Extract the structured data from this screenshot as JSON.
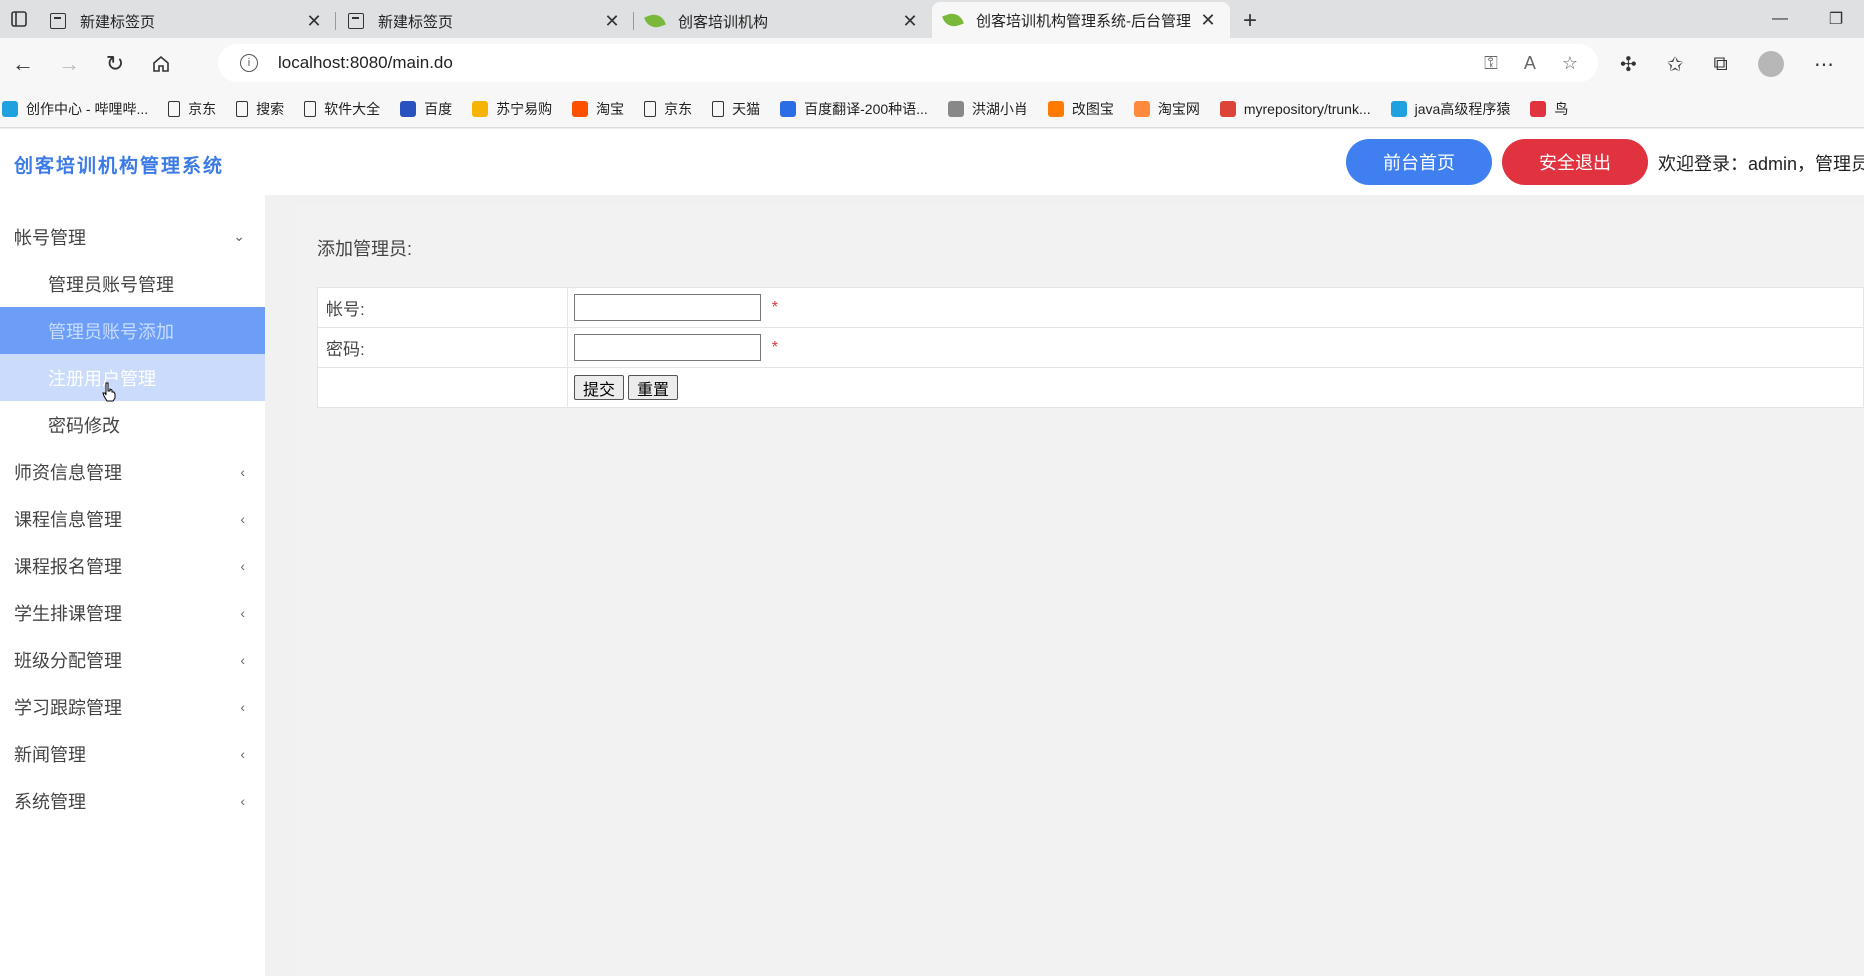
{
  "browser": {
    "tabs": [
      {
        "title": "新建标签页",
        "icon": "page-icon",
        "active": false
      },
      {
        "title": "新建标签页",
        "icon": "page-icon",
        "active": false
      },
      {
        "title": "创客培训机构",
        "icon": "leaf-icon",
        "active": false
      },
      {
        "title": "创客培训机构管理系统-后台管理",
        "icon": "leaf-icon",
        "active": true
      }
    ],
    "url": "localhost:8080/main.do",
    "bookmarks": [
      {
        "label": "创作中心 - 哔哩哔...",
        "icon": "bilibili-icon",
        "color": "#1fa1e0"
      },
      {
        "label": "京东",
        "icon": "page-icon"
      },
      {
        "label": "搜索",
        "icon": "page-icon"
      },
      {
        "label": "软件大全",
        "icon": "page-icon"
      },
      {
        "label": "百度",
        "icon": "baidu-paw-icon",
        "color": "#2a52be"
      },
      {
        "label": "苏宁易购",
        "icon": "suning-icon",
        "color": "#f5b400"
      },
      {
        "label": "淘宝",
        "icon": "taobao-icon",
        "color": "#ff5000"
      },
      {
        "label": "京东",
        "icon": "page-icon"
      },
      {
        "label": "天猫",
        "icon": "page-icon"
      },
      {
        "label": "百度翻译-200种语...",
        "icon": "translate-icon",
        "color": "#2b6de5"
      },
      {
        "label": "洪湖小肖",
        "icon": "bird-icon",
        "color": "#888888"
      },
      {
        "label": "改图宝",
        "icon": "gaitubao-icon",
        "color": "#ff7a00"
      },
      {
        "label": "淘宝网",
        "icon": "taobao-icon",
        "color": "#ff8a3d"
      },
      {
        "label": "myrepository/trunk...",
        "icon": "chrome-icon",
        "color": "#db4437"
      },
      {
        "label": "java高级程序猿",
        "icon": "bilibili-icon",
        "color": "#1fa1e0"
      },
      {
        "label": "鸟",
        "icon": "bird-icon",
        "color": "#e0323f"
      }
    ]
  },
  "header": {
    "title": "创客培训机构管理系统",
    "home_button": "前台首页",
    "logout_button": "安全退出",
    "welcome": "欢迎登录：admin，管理员"
  },
  "sidebar": {
    "account_group": "帐号管理",
    "account_items": [
      {
        "label": "管理员账号管理"
      },
      {
        "label": "管理员账号添加"
      },
      {
        "label": "注册用户管理"
      },
      {
        "label": "密码修改"
      }
    ],
    "groups": [
      {
        "label": "师资信息管理"
      },
      {
        "label": "课程信息管理"
      },
      {
        "label": "课程报名管理"
      },
      {
        "label": "学生排课管理"
      },
      {
        "label": "班级分配管理"
      },
      {
        "label": "学习跟踪管理"
      },
      {
        "label": "新闻管理"
      },
      {
        "label": "系统管理"
      }
    ]
  },
  "main": {
    "heading": "添加管理员:",
    "account_label": "帐号:",
    "password_label": "密码:",
    "required_mark": "*",
    "submit_button": "提交",
    "reset_button": "重置"
  },
  "colors": {
    "brand": "#3c7be6",
    "home_button": "#3f7ff0",
    "logout_button": "#e0323f",
    "sidebar_active": "#6d9ef7",
    "sidebar_hover": "#cadbfb"
  }
}
